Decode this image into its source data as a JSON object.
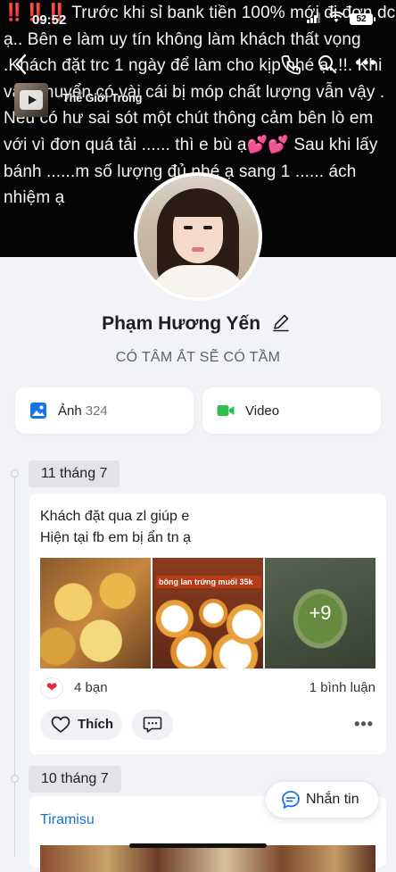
{
  "status_bar": {
    "time": "09:52",
    "battery": "52"
  },
  "cover": {
    "text": "‼️‼️‼️ Trước khi sỉ bank tiền 100% mới đi đơn dc ạ.. Bên e làm uy tín không làm khách thất vọng .Khách đặt trc 1 ngày để làm cho kịp nhé ạ..!!. Khi vận chuyển có vài cái bị móp chất lượng vẫn vậy . Nếu có hư sai sót một chút thông cảm bên lò em với vì đơn quá tải ...... thì e bù ạ💕💕 Sau khi lấy bánh ......m số lượng đủ nhé ạ sang 1 ...... ách nhiệm ạ",
    "music_label": "Thế Giới Trong",
    "more_icon": "more-dots-icon"
  },
  "profile": {
    "name": "Phạm Hương Yến",
    "bio": "CÓ TÂM ẮT SẼ CÓ TẦM"
  },
  "media_buttons": {
    "photos_label": "Ảnh",
    "photos_count": "324",
    "video_label": "Video"
  },
  "timeline": {
    "date_1": "11 tháng 7",
    "date_2": "10 tháng 7"
  },
  "post_1": {
    "text": "Khách đặt qua zl giúp e\nHiện tại fb em bị ẩn tn ạ",
    "photo_2_caption": "bông lan trứng muối 35k",
    "more_photos": "+9",
    "reaction_count": "4 bạn",
    "comment_count": "1 bình luận",
    "like_label": "Thích"
  },
  "post_2": {
    "link_text": "Tiramisu"
  },
  "message_button": {
    "label": "Nhắn tin"
  },
  "colors": {
    "accent": "#1a6fd6",
    "background": "#f2f3f7",
    "heart": "#e02b3c"
  }
}
